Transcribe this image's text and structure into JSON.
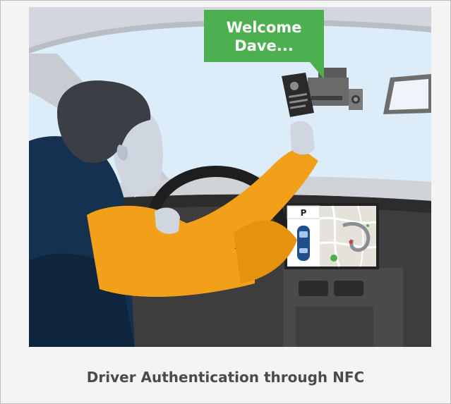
{
  "speech_bubble": {
    "line1": "Welcome",
    "line2": "Dave..."
  },
  "infotainment_screen": {
    "parking_label": "P"
  },
  "caption": "Driver Authentication through NFC",
  "colors": {
    "sky": "#dcecf8",
    "car_interior": "#3d3d3d",
    "sleeve": "#f29f19",
    "jacket": "#14314f",
    "bubble": "#4caf50"
  },
  "icons": [
    "nfc-card-icon",
    "dashcam-device-icon",
    "steering-wheel-icon",
    "map-icon",
    "car-icon"
  ]
}
